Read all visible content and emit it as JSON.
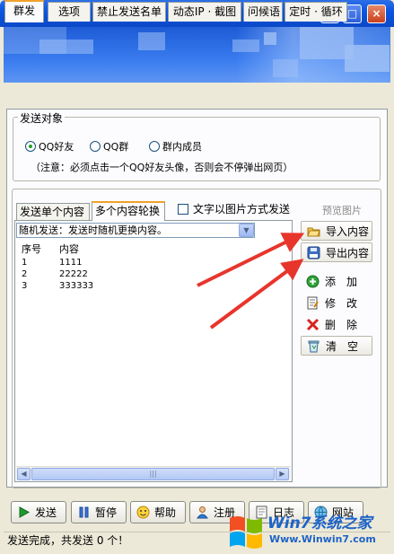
{
  "window": {
    "title": "群"
  },
  "tabs": [
    "群发",
    "选项",
    "禁止发送名单",
    "动态IP · 截图",
    "问候语",
    "定时 · 循环"
  ],
  "target_group": {
    "title": "发送对象",
    "options": [
      "QQ好友",
      "QQ群",
      "群内成员"
    ],
    "selected": "QQ好友",
    "note": "（注意：必须点击一个QQ好友头像，否则会不停弹出网页）"
  },
  "content_tabs": [
    "发送单个内容",
    "多个内容轮换"
  ],
  "image_checkbox_label": "文字以图片方式发送",
  "preview_label": "预览图片",
  "mode_select": {
    "value": "随机发送：发送时随机更换内容。"
  },
  "list": {
    "columns": [
      "序号",
      "内容"
    ],
    "rows": [
      {
        "index": "1",
        "content": "1111"
      },
      {
        "index": "2",
        "content": "22222"
      },
      {
        "index": "3",
        "content": "333333"
      }
    ]
  },
  "side_buttons": {
    "import": "导入内容",
    "export": "导出内容",
    "add": "添　加",
    "edit": "修　改",
    "delete": "删　除",
    "clear": "清　空"
  },
  "bottom_buttons": {
    "send": "发送",
    "pause": "暂停",
    "help": "帮助",
    "register": "注册",
    "log": "日志",
    "website": "网站"
  },
  "status": "发送完成，共发送 0 个！",
  "watermark": {
    "brand": "Win7系统之家",
    "url": "Www.Winwin7.com"
  },
  "colors": {
    "titlebar": "#0b56e0",
    "tab_accent": "#f1a12b",
    "arrow": "#e8352b",
    "watermark": "#1d63c7"
  }
}
